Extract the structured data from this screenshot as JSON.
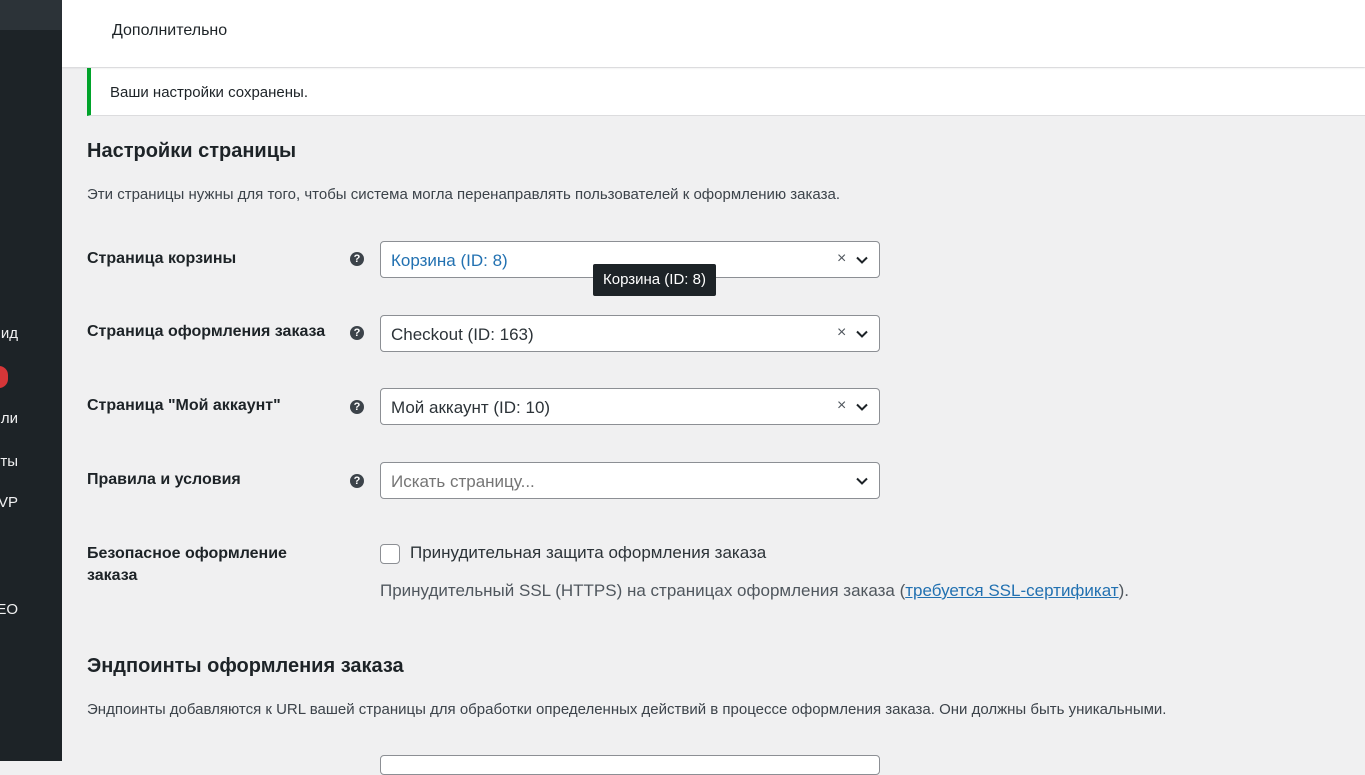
{
  "sidebar": {
    "items": [
      {
        "label": "ид"
      },
      {
        "label": "ли"
      },
      {
        "label": "ты"
      },
      {
        "label": "VP"
      },
      {
        "label": "EO"
      }
    ]
  },
  "header": {
    "title": "Дополнительно"
  },
  "notice": {
    "text": "Ваши настройки сохранены."
  },
  "page_settings": {
    "title": "Настройки страницы",
    "description": "Эти страницы нужны для того, чтобы система могла перенаправлять пользователей к оформлению заказа.",
    "fields": [
      {
        "label": "Страница корзины",
        "value": "Корзина (ID: 8)",
        "clear": "×"
      },
      {
        "label": "Страница оформления заказа",
        "value": "Checkout (ID: 163)",
        "clear": "×"
      },
      {
        "label": "Страница \"Мой аккаунт\"",
        "value": "Мой аккаунт (ID: 10)",
        "clear": "×"
      },
      {
        "label": "Правила и условия",
        "placeholder": "Искать страницу..."
      }
    ],
    "help_glyph": "?",
    "tooltip": "Корзина (ID: 8)",
    "secure_checkout": {
      "label": "Безопасное оформление заказа",
      "checkbox_label": "Принудительная защита оформления заказа",
      "checked": false,
      "desc_prefix": "Принудительный SSL (HTTPS) на страницах оформления заказа (",
      "desc_link": "требуется SSL-сертификат",
      "desc_suffix": ")."
    }
  },
  "endpoints": {
    "title": "Эндпоинты оформления заказа",
    "description": "Эндпоинты добавляются к URL вашей страницы для обработки определенных действий в процессе оформления заказа. Они должны быть уникальными."
  },
  "colors": {
    "sidebar_bg": "#1d2327",
    "link": "#2271b1",
    "success": "#00a32a",
    "badge": "#d63638"
  }
}
